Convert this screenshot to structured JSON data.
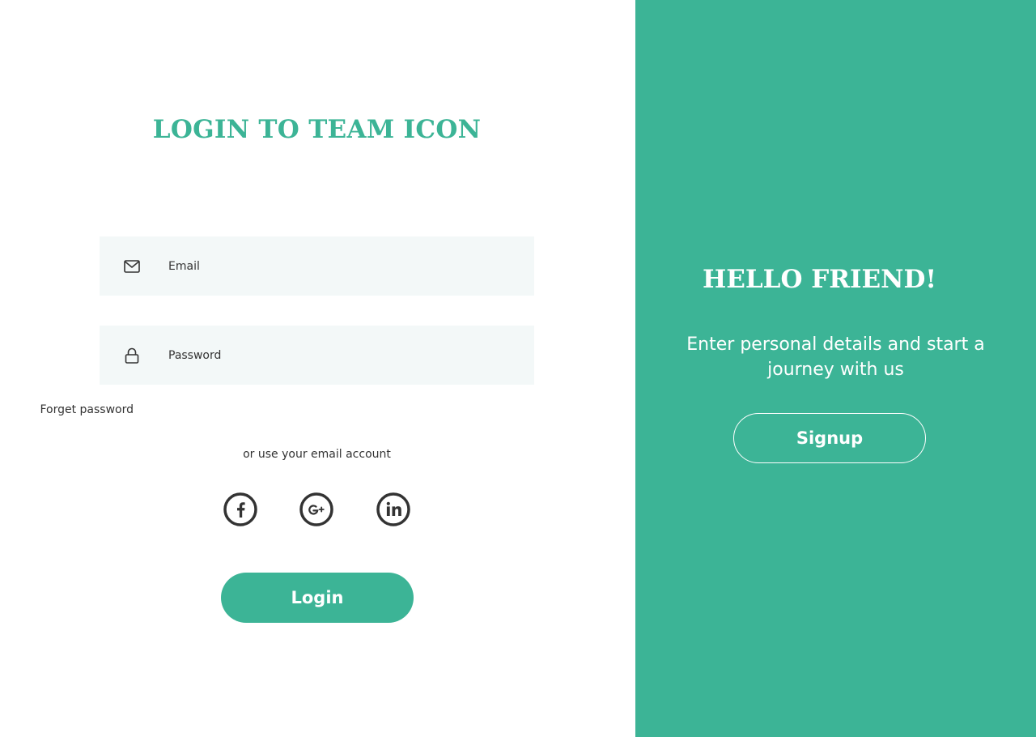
{
  "login": {
    "title": "LOGIN TO TEAM ICON",
    "email": {
      "placeholder": "Email",
      "value": "",
      "icon": "mail-icon"
    },
    "password": {
      "placeholder": "Password",
      "value": "",
      "icon": "lock-icon"
    },
    "forget_label": "Forget password",
    "alt_text": "or use your email account",
    "social": [
      {
        "name": "facebook",
        "icon": "facebook-icon"
      },
      {
        "name": "google-plus",
        "icon": "google-plus-icon"
      },
      {
        "name": "linkedin",
        "icon": "linkedin-icon"
      }
    ],
    "button_label": "Login"
  },
  "welcome": {
    "title": "HELLO FRIEND!",
    "subtitle": "Enter personal details and start a journey with us",
    "button_label": "Signup"
  },
  "colors": {
    "accent": "#3cb496",
    "field_background": "#f3f8f8",
    "text": "#333333",
    "icon": "#333333"
  }
}
